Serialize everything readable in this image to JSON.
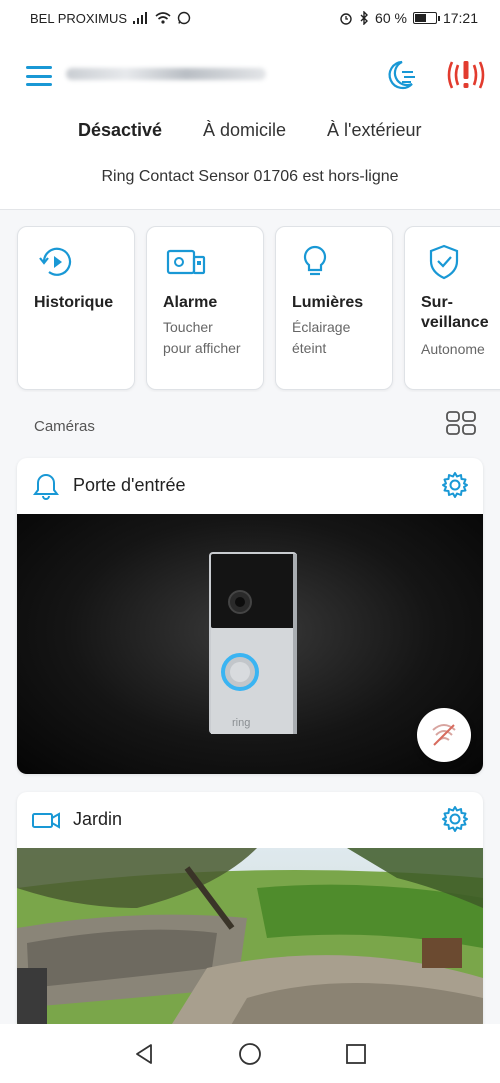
{
  "status_bar": {
    "carrier": "BEL PROXIMUS",
    "battery_text": "60 %",
    "battery_level": 0.6,
    "time": "17:21"
  },
  "header": {
    "menu_icon": "hamburger-icon",
    "moon_icon": "moon-icon",
    "alert_icon": "alert-icon"
  },
  "modes": [
    {
      "label": "Désactivé",
      "active": true
    },
    {
      "label": "À domicile",
      "active": false
    },
    {
      "label": "À l'extérieur",
      "active": false
    }
  ],
  "status_message": "Ring Contact Sensor 01706 est hors-ligne",
  "tiles": [
    {
      "title": "Historique",
      "sub1": "",
      "sub2": "",
      "icon": "history-icon"
    },
    {
      "title": "Alarme",
      "sub1": "Toucher",
      "sub2": "pour afficher",
      "icon": "alarm-panel-icon"
    },
    {
      "title": "Lumières",
      "sub1": "Éclairage",
      "sub2": "éteint",
      "icon": "lightbulb-icon"
    },
    {
      "title": "Sur-",
      "title2": "veillance",
      "sub1": "Autonome",
      "sub2": "",
      "icon": "shield-check-icon"
    }
  ],
  "cameras_label": "Caméras",
  "cameras": [
    {
      "name": "Porte d'entrée",
      "icon": "bell-icon"
    },
    {
      "name": "Jardin",
      "icon": "video-camera-icon"
    }
  ],
  "doorbell_brand": "ring",
  "colors": {
    "accent": "#1998d5",
    "alert": "#e23b2e"
  }
}
